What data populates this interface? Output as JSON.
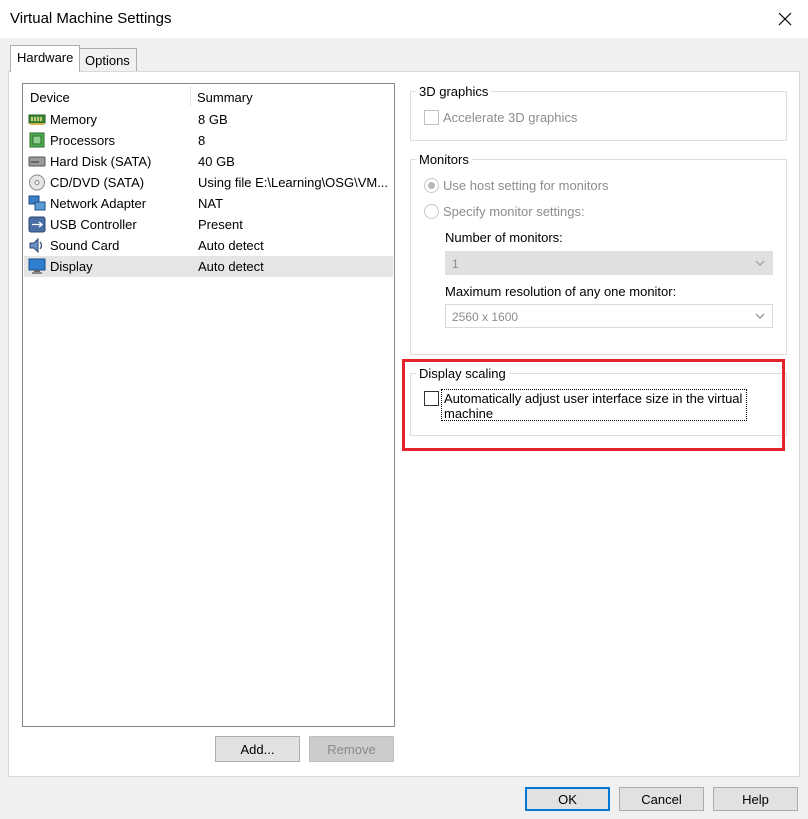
{
  "window": {
    "title": "Virtual Machine Settings"
  },
  "tabs": [
    {
      "label": "Hardware",
      "active": true
    },
    {
      "label": "Options",
      "active": false
    }
  ],
  "device_list": {
    "columns": [
      "Device",
      "Summary"
    ],
    "rows": [
      {
        "device": "Memory",
        "summary": "8 GB",
        "icon": "memory-icon"
      },
      {
        "device": "Processors",
        "summary": "8",
        "icon": "processor-icon"
      },
      {
        "device": "Hard Disk (SATA)",
        "summary": "40 GB",
        "icon": "hard-disk-icon"
      },
      {
        "device": "CD/DVD (SATA)",
        "summary": "Using file E:\\Learning\\OSG\\VM...",
        "icon": "cd-dvd-icon"
      },
      {
        "device": "Network Adapter",
        "summary": "NAT",
        "icon": "network-adapter-icon"
      },
      {
        "device": "USB Controller",
        "summary": "Present",
        "icon": "usb-controller-icon"
      },
      {
        "device": "Sound Card",
        "summary": "Auto detect",
        "icon": "sound-card-icon"
      },
      {
        "device": "Display",
        "summary": "Auto detect",
        "icon": "display-icon",
        "selected": true
      }
    ],
    "add_button": "Add...",
    "remove_button": "Remove"
  },
  "graphics": {
    "group_label": "3D graphics",
    "accelerate_label": "Accelerate 3D graphics",
    "accelerate_checked": false
  },
  "monitors": {
    "group_label": "Monitors",
    "use_host_label": "Use host setting for monitors",
    "specify_label": "Specify monitor settings:",
    "selected_option": "use_host",
    "number_label": "Number of monitors:",
    "number_value": "1",
    "max_res_label": "Maximum resolution of any one monitor:",
    "max_res_value": "2560 x 1600"
  },
  "scaling": {
    "group_label": "Display scaling",
    "auto_adjust_label_line1": "Automatically adjust user interface size in the virtual",
    "auto_adjust_label_line2": "machine",
    "auto_adjust_checked": false
  },
  "footer": {
    "ok": "OK",
    "cancel": "Cancel",
    "help": "Help"
  },
  "colors": {
    "highlight": "#e3242b",
    "default_button_border": "#0078d7",
    "selected_row": "#e5e5e5"
  }
}
